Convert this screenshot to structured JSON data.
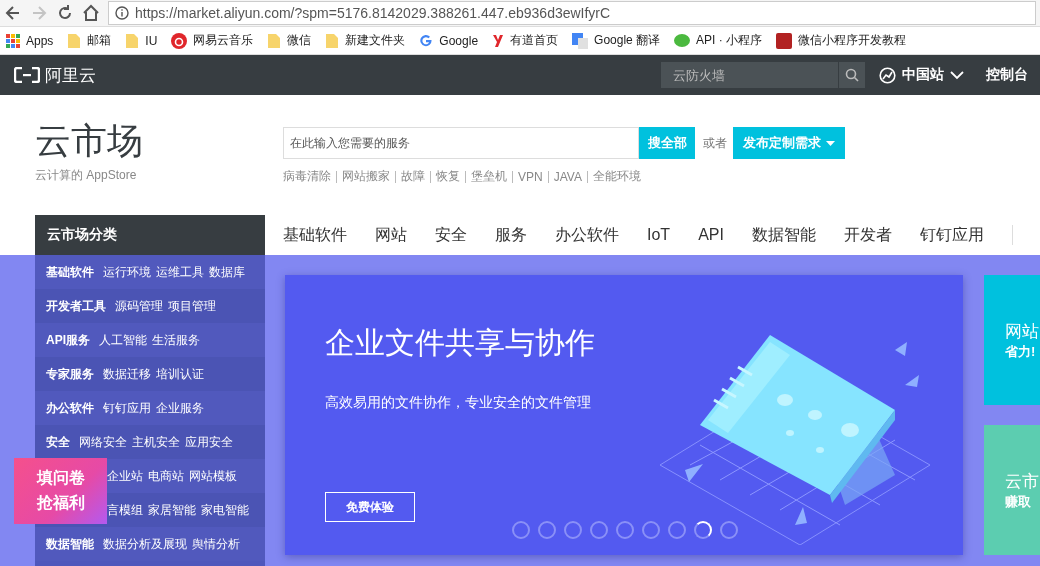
{
  "browser": {
    "nav_buttons": [
      {
        "kind": "back",
        "disabled": false
      },
      {
        "kind": "forward",
        "disabled": true
      },
      {
        "kind": "reload",
        "disabled": false
      },
      {
        "kind": "home",
        "disabled": false
      }
    ],
    "url": "https://market.aliyun.com/?spm=5176.8142029.388261.447.eb936d3ewIfyrC",
    "bookmarks": [
      {
        "label": "Apps",
        "kind": "apps"
      },
      {
        "label": "邮箱",
        "kind": "folder"
      },
      {
        "label": "IU",
        "kind": "folder"
      },
      {
        "label": "网易云音乐",
        "kind": "music"
      },
      {
        "label": "微信",
        "kind": "folder"
      },
      {
        "label": "新建文件夹",
        "kind": "folder"
      },
      {
        "label": "Google",
        "kind": "google"
      },
      {
        "label": "有道首页",
        "kind": "youdao"
      },
      {
        "label": "Google 翻译",
        "kind": "translate"
      },
      {
        "label": "API · 小程序",
        "kind": "chat"
      },
      {
        "label": "微信小程序开发教程",
        "kind": "w3c"
      }
    ]
  },
  "top_bar": {
    "logo": "阿里云",
    "search": {
      "placeholder": "云防火墙"
    },
    "region": "中国站",
    "console": "控制台"
  },
  "header": {
    "title": "云市场",
    "subtitle": "云计算的 AppStore",
    "search": {
      "placeholder": "在此输入您需要的服务"
    },
    "search_button": "搜全部",
    "or": "或者",
    "publish_button": "发布定制需求",
    "hot_links": [
      "病毒清除",
      "网站搬家",
      "故障",
      "恢复",
      "堡垒机",
      "VPN",
      "JAVA",
      "全能环境"
    ]
  },
  "categories_title": "云市场分类",
  "nav": [
    "基础软件",
    "网站",
    "安全",
    "服务",
    "办公软件",
    "IoT",
    "API",
    "数据智能",
    "开发者",
    "钉钉应用"
  ],
  "categories": [
    {
      "name": "基础软件",
      "subs": [
        "运行环境",
        "运维工具",
        "数据库"
      ]
    },
    {
      "name": "开发者工具",
      "subs": [
        "源码管理",
        "项目管理"
      ]
    },
    {
      "name": "API服务",
      "subs": [
        "人工智能",
        "生活服务"
      ]
    },
    {
      "name": "专家服务",
      "subs": [
        "数据迁移",
        "培训认证"
      ]
    },
    {
      "name": "办公软件",
      "subs": [
        "钉钉应用",
        "企业服务"
      ]
    },
    {
      "name": "安全",
      "subs": [
        "网络安全",
        "主机安全",
        "应用安全"
      ]
    },
    {
      "subs": [
        "企业站",
        "电商站",
        "网站模板"
      ]
    },
    {
      "subs": [
        "言模组",
        "家居智能",
        "家电智能"
      ]
    },
    {
      "name": "数据智能",
      "subs": [
        "数据分析及展现",
        "舆情分析"
      ]
    }
  ],
  "banner": {
    "title": "企业文件共享与协作",
    "subtitle": "高效易用的文件协作，专业安全的文件管理",
    "button": "免费体验",
    "dots": [
      {
        "selected": false
      },
      {
        "selected": false
      },
      {
        "selected": false
      },
      {
        "selected": false
      },
      {
        "selected": false
      },
      {
        "selected": false
      },
      {
        "selected": false
      },
      {
        "selected": true
      },
      {
        "selected": false
      }
    ]
  },
  "side_cards": [
    {
      "title": "网站",
      "text": "省力!",
      "color": "#00c1de"
    },
    {
      "title": "云市",
      "text": "赚取",
      "color": "#5ccdb0"
    }
  ],
  "survey": [
    "填问卷",
    "抢福利"
  ]
}
